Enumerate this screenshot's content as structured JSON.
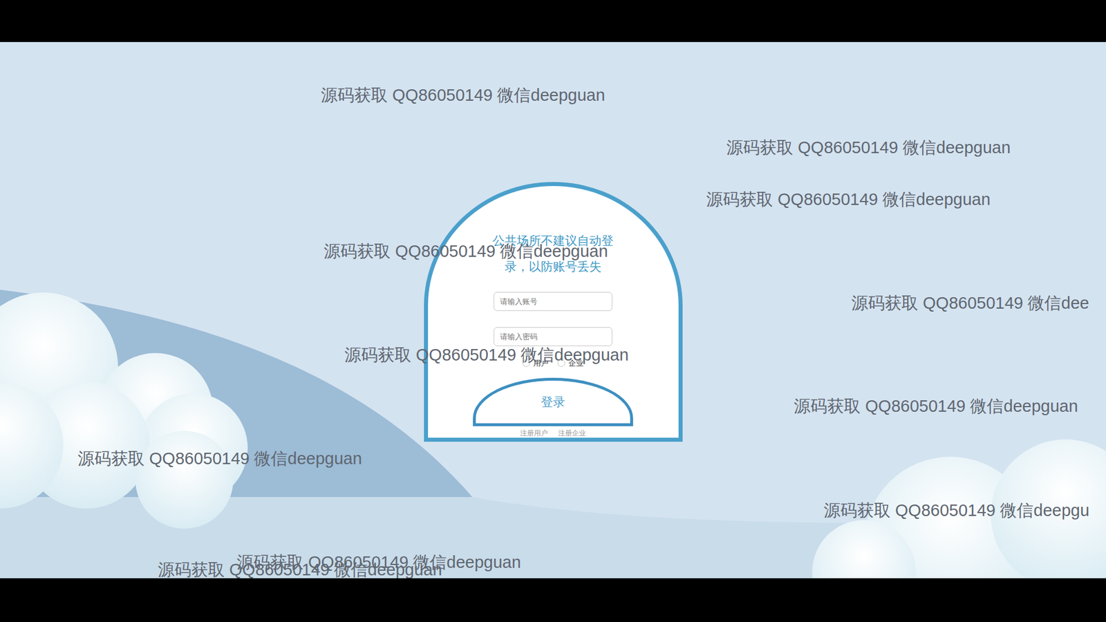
{
  "watermarks": [
    "源码获取 QQ86050149 微信deepguan",
    "源码获取 QQ86050149 微信deepguan",
    "源码获取 QQ86050149 微信deepguan",
    "源码获取 QQ86050149 微信deepguan",
    "源码获取 QQ86050149 微信dee",
    "源码获取 QQ86050149 微信deepguan",
    "源码获取 QQ86050149 微信deepguan",
    "源码获取 QQ86050149 微信deepguan",
    "源码获取 QQ86050149 微信deepgu",
    "源码获取 QQ86050149 微信deepguan",
    "源码获取 QQ86050149 微信deepguan"
  ],
  "login": {
    "notice": "公共场所不建议自动登录，以防账号丢失",
    "account": {
      "placeholder": "请输入账号"
    },
    "password": {
      "placeholder": "请输入密码"
    },
    "roles": [
      {
        "label": "用户",
        "selected": false
      },
      {
        "label": "企业",
        "selected": false
      }
    ],
    "submit": "登录",
    "links": [
      "注册用户",
      "注册企业"
    ]
  }
}
